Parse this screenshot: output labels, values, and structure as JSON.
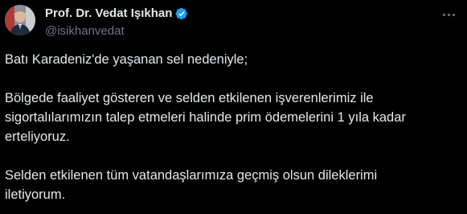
{
  "author": {
    "display_name": "Prof. Dr. Vedat Işıkhan",
    "handle": "@isikhanvedat",
    "verified": true,
    "verified_color": "#1d9bf0"
  },
  "icons": {
    "avatar": "avatar-photo",
    "verified": "verified-badge-icon",
    "more": "more-options-icon"
  },
  "tweet": {
    "paragraphs": [
      "Batı Karadeniz'de yaşanan sel nedeniyle;",
      "Bölgede faaliyet gösteren ve selden etkilenen işverenlerimiz ile\nsigortalılarımızın talep etmeleri halinde prim ödemelerini 1 yıla kadar\nerteliyoruz.",
      "Selden etkilenen tüm vatandaşlarımıza geçmiş olsun dileklerimi\niletiyorum."
    ]
  },
  "colors": {
    "background": "#000000",
    "text": "#e7e9ea",
    "secondary_text": "#71767b"
  }
}
